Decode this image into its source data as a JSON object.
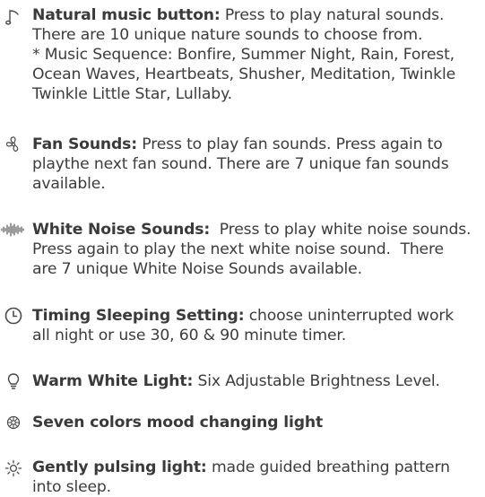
{
  "features": [
    {
      "icon": "music-note-icon",
      "label": "Natural music button:",
      "description": " Press to play natural sounds. There are 10 unique nature sounds to choose from.",
      "note": "* Music Sequence: Bonfire, Summer Night, Rain, Forest, Ocean Waves, Heartbeats, Shusher, Meditation, Twinkle Twinkle Little Star, Lullaby."
    },
    {
      "icon": "fan-icon",
      "label": "Fan Sounds:",
      "description": " Press to play fan sounds. Press again to playthe next fan sound. There are 7 unique fan sounds available."
    },
    {
      "icon": "sound-wave-icon",
      "label": "White Noise Sounds:",
      "description": "  Press to play white noise sounds. Press again to play the next white noise sound.  There are 7 unique White Noise Sounds available."
    },
    {
      "icon": "clock-icon",
      "label": "Timing Sleeping Setting:",
      "description": " choose uninterrupted work all night or use 30, 60 & 90 minute timer."
    },
    {
      "icon": "light-bulb-icon",
      "label": "Warm White Light:",
      "description": " Six Adjustable Brightness Level."
    },
    {
      "icon": "color-wheel-icon",
      "label": "Seven colors mood changing light",
      "description": ""
    },
    {
      "icon": "pulsing-light-icon",
      "label": "Gently pulsing light:",
      "description": " made guided breathing pattern into sleep."
    }
  ],
  "lines": {
    "f0": [
      "Press to play natural sounds.",
      "There are 10 unique nature sounds to choose from.",
      "* Music Sequence: Bonfire, Summer Night, Rain, Forest,",
      "Ocean Waves, Heartbeats, Shusher, Meditation, Twinkle",
      "Twinkle Little Star, Lullaby."
    ],
    "f1": [
      "Press to play fan sounds. Press again to",
      "playthe next fan sound. There are 7 unique fan sounds",
      "available."
    ],
    "f2": [
      "Press to play white noise sounds.",
      "Press again to play the next white noise sound.  There",
      "are 7 unique White Noise Sounds available."
    ],
    "f3": [
      "choose uninterrupted work",
      "all night or use 30, 60 & 90 minute timer."
    ],
    "f6": [
      "made guided breathing pattern",
      "into sleep."
    ]
  },
  "colors": {
    "text": "#3c3c3c",
    "icon": "#4a4a4a"
  }
}
